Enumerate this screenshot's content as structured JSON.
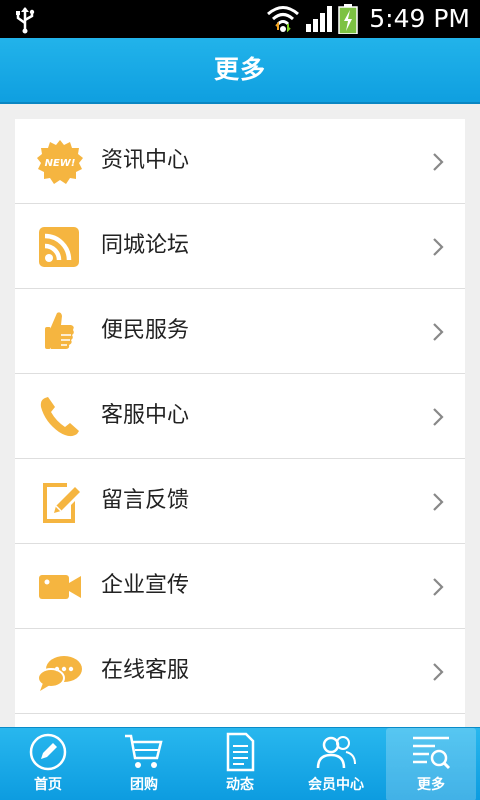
{
  "status_bar": {
    "time": "5:49 PM",
    "icons": [
      "usb-icon",
      "wifi-icon",
      "signal-icon",
      "battery-charging-icon"
    ]
  },
  "header": {
    "title": "更多"
  },
  "menu": {
    "items": [
      {
        "label": "资讯中心",
        "icon": "new-badge-icon"
      },
      {
        "label": "同城论坛",
        "icon": "rss-icon"
      },
      {
        "label": "便民服务",
        "icon": "thumbs-up-icon"
      },
      {
        "label": "客服中心",
        "icon": "phone-icon"
      },
      {
        "label": "留言反馈",
        "icon": "edit-note-icon"
      },
      {
        "label": "企业宣传",
        "icon": "video-camera-icon"
      },
      {
        "label": "在线客服",
        "icon": "chat-bubbles-icon"
      }
    ]
  },
  "tabbar": {
    "tabs": [
      {
        "label": "首页",
        "icon": "pencil-circle-icon"
      },
      {
        "label": "团购",
        "icon": "shopping-cart-icon"
      },
      {
        "label": "动态",
        "icon": "document-icon"
      },
      {
        "label": "会员中心",
        "icon": "users-icon"
      },
      {
        "label": "更多",
        "icon": "list-search-icon"
      }
    ],
    "active_index": 4
  },
  "colors": {
    "accent": "#13a6e4",
    "icon_orange": "#f5b540",
    "text": "#222222"
  },
  "icons": {
    "new_badge_text": "NEW!"
  }
}
